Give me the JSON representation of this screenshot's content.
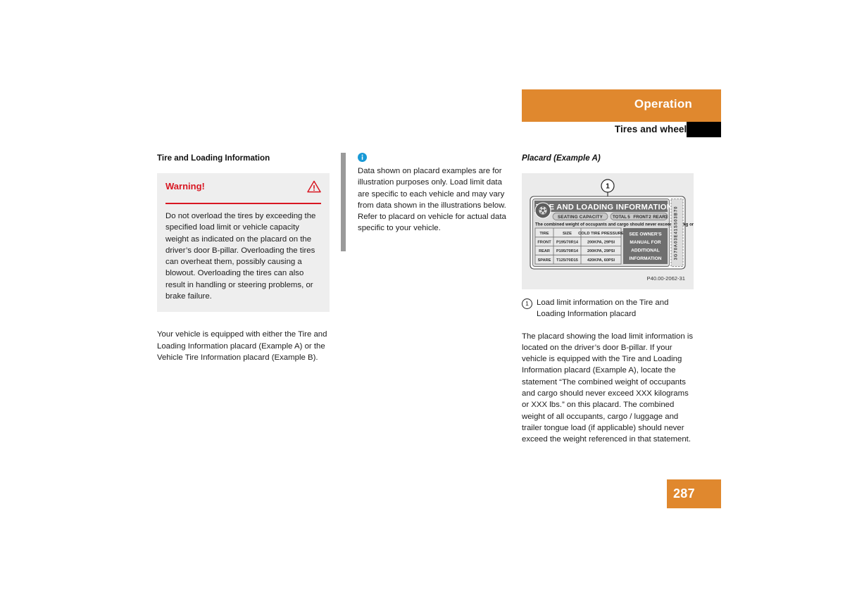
{
  "header": {
    "chapter_title": "Operation",
    "section_title": "Tires and wheels",
    "accent_color": "#e0882e",
    "marker_color": "#000000"
  },
  "left_column": {
    "heading": "Tire and Loading Information",
    "warning": {
      "title": "Warning!",
      "icon": "warning-triangle-icon",
      "accent_color": "#d81722",
      "body": "Do not overload the tires by exceeding the specified load limit or vehicle capacity weight as indicated on the placard on the driver’s door B-pillar. Overloading the tires can overheat them, possibly causing a blowout. Overloading the tires can also result in handling or steering problems, or brake failure."
    },
    "paragraph": "Your vehicle is equipped with either the Tire and Loading Information placard (Example A) or the Vehicle Tire Information placard (Example B)."
  },
  "middle_column": {
    "note": {
      "icon": "info-icon",
      "icon_color": "#1899d6",
      "bar_color": "#9a9a9a",
      "body": "Data shown on placard examples are for illustration purposes only. Load limit data are specific to each vehicle and may vary from data shown in the illustrations below. Refer to placard on vehicle for actual data specific to your vehicle."
    }
  },
  "right_column": {
    "heading": "Placard (Example A)",
    "figure": {
      "callout_number": "1",
      "image_code": "P40.00-2062-31",
      "placard": {
        "title": "TIRE AND LOADING INFORMATION",
        "seating_capacity_label": "SEATING CAPACITY",
        "seating_total_label": "TOTAL",
        "seating_total_value": "5",
        "seating_front_label": "FRONT",
        "seating_front_value": "2",
        "seating_rear_label": "REAR",
        "seating_rear_value": "3",
        "combined_weight_statement": "The combined weight of occupants and cargo should never exceed XXX kg or XXX lbs.*",
        "table_headers": [
          "TIRE",
          "SIZE",
          "COLD TIRE PRESSURE"
        ],
        "table_rows": [
          [
            "FRONT",
            "P195/70R14",
            "200KPA, 29PSI"
          ],
          [
            "REAR",
            "P195/70R14",
            "200KPA, 29PSI"
          ],
          [
            "SPARE",
            "T125/70D15",
            "420KPA, 60PSI"
          ]
        ],
        "side_note_lines": [
          "SEE OWNER'S",
          "MANUAL FOR",
          "ADDITIONAL",
          "INFORMATION"
        ],
        "serial_vertical": "3G70A03E41S503B70"
      }
    },
    "caption": {
      "number": "1",
      "text": "Load limit information on the Tire and Loading Information placard"
    },
    "paragraph": "The placard showing the load limit information is located on the driver’s door B-pillar. If your vehicle is equipped with the Tire and Loading Information placard (Example A), locate the statement “The combined weight of occupants and cargo should never exceed XXX kilograms or XXX lbs.” on this placard. The combined weight of all occupants, cargo / luggage and trailer tongue load (if applicable) should never exceed the weight referenced in that statement."
  },
  "footer": {
    "page_number": "287"
  }
}
